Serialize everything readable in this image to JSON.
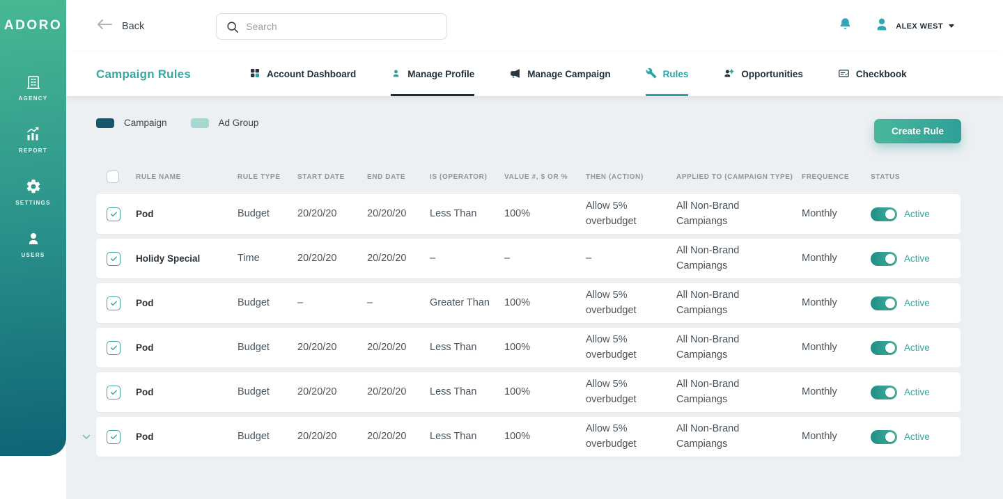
{
  "colors": {
    "accent_teal": "#2ba3a3",
    "sidebar_top": "#48b893",
    "sidebar_bottom": "#0f6376",
    "status_active": "#33a79c",
    "legend_campaign": "#18566b",
    "legend_ad_group": "#a7d7d1"
  },
  "icons": {
    "back-arrow-icon": "long-left-arrow",
    "search-icon": "magnifier",
    "bell-icon": "bell",
    "avatar-icon": "person",
    "caret-down-icon": "caret-down-triangle",
    "dashboard-icon": "grid-2x2",
    "profile-icon": "person",
    "campaign-icon": "megaphone",
    "rules-icon": "wrench-hammer",
    "opportunities-icon": "person-with-gear",
    "checkbook-icon": "cheque-book",
    "agency-icon": "office-building",
    "report-icon": "bar-chart-with-arrow",
    "settings-icon": "gear",
    "users-icon": "person",
    "row-checkbox-icon": "checkmark",
    "collapse-chevron-icon": "chevron-down"
  },
  "sidebar": {
    "logo": "ADORO",
    "items": [
      {
        "label": "AGENCY"
      },
      {
        "label": "REPORT"
      },
      {
        "label": "SETTINGS"
      },
      {
        "label": "USERS"
      }
    ]
  },
  "header": {
    "back_label": "Back",
    "search_placeholder": "Search",
    "user_name": "ALEX WEST"
  },
  "subnav": {
    "page_title": "Campaign Rules",
    "tabs": [
      {
        "label": "Account Dashboard",
        "active": false
      },
      {
        "label": "Manage Profile",
        "active": true,
        "emphasis": "dark"
      },
      {
        "label": "Manage Campaign",
        "active": false
      },
      {
        "label": "Rules",
        "active": true,
        "emphasis": "teal"
      },
      {
        "label": "Opportunities",
        "active": false
      },
      {
        "label": "Checkbook",
        "active": false
      }
    ]
  },
  "legend": [
    {
      "label": "Campaign",
      "color": "#18566b"
    },
    {
      "label": "Ad Group",
      "color": "#a7d7d1"
    }
  ],
  "create_rule_label": "Create Rule",
  "table": {
    "columns": [
      "RULE NAME",
      "RULE TYPE",
      "START DATE",
      "END DATE",
      "IS (OPERATOR)",
      "VALUE #, $ OR %",
      "THEN (ACTION)",
      "APPLIED TO (CAMPAIGN TYPE)",
      "FREQUENCE",
      "STATUS"
    ],
    "rows": [
      {
        "rule_name": "Pod",
        "rule_type": "Budget",
        "start_date": "20/20/20",
        "end_date": "20/20/20",
        "operator": "Less Than",
        "value": "100%",
        "action": "Allow 5% overbudget",
        "applied_to": "All Non-Brand Campiangs",
        "frequence": "Monthly",
        "status": "Active",
        "checked": true,
        "enabled": true
      },
      {
        "rule_name": "Holidy Special",
        "rule_type": "Time",
        "start_date": "20/20/20",
        "end_date": "20/20/20",
        "operator": "–",
        "value": "–",
        "action": "–",
        "applied_to": "All Non-Brand Campiangs",
        "frequence": "Monthly",
        "status": "Active",
        "checked": true,
        "enabled": true
      },
      {
        "rule_name": "Pod",
        "rule_type": "Budget",
        "start_date": "–",
        "end_date": "–",
        "operator": "Greater Than",
        "value": "100%",
        "action": "Allow 5% overbudget",
        "applied_to": "All Non-Brand Campiangs",
        "frequence": "Monthly",
        "status": "Active",
        "checked": true,
        "enabled": true
      },
      {
        "rule_name": "Pod",
        "rule_type": "Budget",
        "start_date": "20/20/20",
        "end_date": "20/20/20",
        "operator": "Less Than",
        "value": "100%",
        "action": "Allow 5% overbudget",
        "applied_to": "All Non-Brand Campiangs",
        "frequence": "Monthly",
        "status": "Active",
        "checked": true,
        "enabled": true
      },
      {
        "rule_name": "Pod",
        "rule_type": "Budget",
        "start_date": "20/20/20",
        "end_date": "20/20/20",
        "operator": "Less Than",
        "value": "100%",
        "action": "Allow 5% overbudget",
        "applied_to": "All Non-Brand Campiangs",
        "frequence": "Monthly",
        "status": "Active",
        "checked": true,
        "enabled": true
      },
      {
        "rule_name": "Pod",
        "rule_type": "Budget",
        "start_date": "20/20/20",
        "end_date": "20/20/20",
        "operator": "Less Than",
        "value": "100%",
        "action": "Allow 5% overbudget",
        "applied_to": "All Non-Brand Campiangs",
        "frequence": "Monthly",
        "status": "Active",
        "checked": true,
        "enabled": true
      }
    ]
  }
}
